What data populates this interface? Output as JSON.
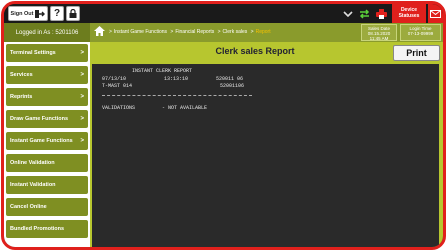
{
  "topbar": {
    "signout_label": "Sign Out",
    "help_label": "?",
    "device_status": [
      "Device",
      "Statuses"
    ],
    "icons": {
      "signout": "logout-arrow-icon",
      "help": "help-icon",
      "lock": "lock-icon",
      "chevron": "chevron-down-icon",
      "network": "transfer-arrows-icon",
      "printer": "printer-icon",
      "mail": "mail-icon"
    }
  },
  "subbar": {
    "logged_in": "Logged in As : 5201106",
    "breadcrumbs": [
      "Instant Game Functions",
      "Financial Reports",
      "Clerk sales",
      "Report"
    ],
    "date_box_1": [
      "Sales Date",
      "08.15.2020",
      "11:45 AM"
    ],
    "date_box_2": [
      "Login Time",
      "07-13-09999"
    ]
  },
  "sidebar": {
    "items": [
      {
        "label": "Terminal Settings",
        "arrow": ">"
      },
      {
        "label": "Services",
        "arrow": ">"
      },
      {
        "label": "Reprints",
        "arrow": ">"
      },
      {
        "label": "Draw Game Functions",
        "arrow": ">"
      },
      {
        "label": "Instant Game Functions",
        "arrow": ">"
      },
      {
        "label": "Online Validation",
        "arrow": ""
      },
      {
        "label": "Instant Validation",
        "arrow": ""
      },
      {
        "label": "Cancel Online",
        "arrow": ""
      },
      {
        "label": "Bundled Promotions",
        "arrow": ""
      }
    ]
  },
  "main": {
    "title": "Clerk sales Report",
    "print_label": "Print",
    "receipt": {
      "header": "INSTANT CLERK REPORT",
      "date": "07/13/10",
      "time": "13:13:10",
      "code1": "520011 06",
      "terminal": "T-MAST 014",
      "code2": "52001106",
      "validations_label": "VALIDATIONS",
      "validations_value": "- NOT AVAILABLE"
    }
  },
  "colors": {
    "frame": "#e0201c",
    "olive": "#8a9b2c",
    "main_bg": "#b7c62f",
    "receipt_bg": "#2a2a2a"
  }
}
